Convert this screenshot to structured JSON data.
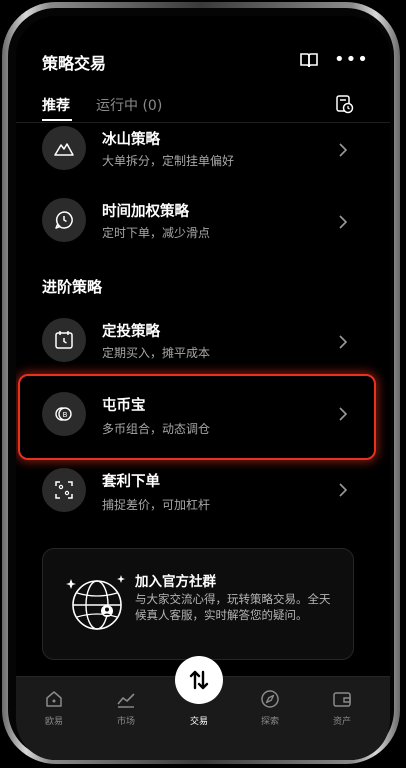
{
  "header": {
    "title": "策略交易",
    "book_icon": "book-icon",
    "more_icon": "more-icon"
  },
  "tabs": {
    "recommended": "推荐",
    "running": "运行中 (0)",
    "history_icon": "clock-history-icon"
  },
  "items": [
    {
      "title": "冰山策略",
      "subtitle": "大单拆分，定制挂单偏好",
      "icon": "mountain-icon"
    },
    {
      "title": "时间加权策略",
      "subtitle": "定时下单，减少滑点",
      "icon": "clock-chat-icon"
    }
  ],
  "section": {
    "title": "进阶策略"
  },
  "advanced_items": [
    {
      "title": "定投策略",
      "subtitle": "定期买入，摊平成本",
      "icon": "calendar-clock-icon"
    },
    {
      "title": "屯币宝",
      "subtitle": "多币组合，动态调仓",
      "icon": "coin-icon"
    },
    {
      "title": "套利下单",
      "subtitle": "捕捉差价，可加杠杆",
      "icon": "scan-icon"
    }
  ],
  "community": {
    "title": "加入官方社群",
    "description": "与大家交流心得，玩转策略交易。全天候真人客服，实时解答您的疑问。",
    "icon": "globe-user-icon"
  },
  "tabbar": {
    "home": "欧易",
    "market": "市场",
    "trade": "交易",
    "explore": "探索",
    "assets": "资产"
  },
  "colors": {
    "highlight": "#e8321e",
    "background": "#000000",
    "icon_circle": "#2b2b2b"
  }
}
